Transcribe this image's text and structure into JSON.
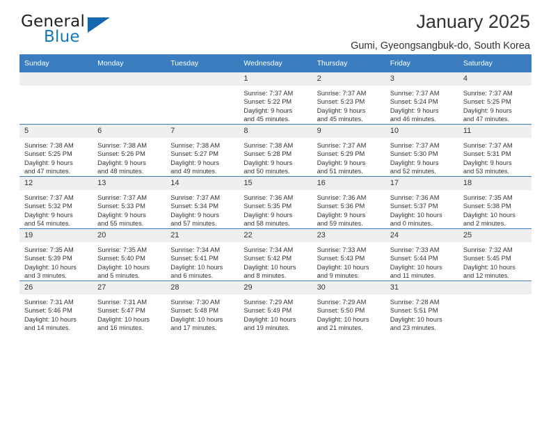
{
  "brand": {
    "name_part1": "General",
    "name_part2": "Blue",
    "triangle_color": "#1568b0",
    "blue_color": "#1278be"
  },
  "header": {
    "title": "January 2025",
    "location": "Gumi, Gyeongsangbuk-do, South Korea"
  },
  "theme": {
    "header_row_bg": "#3a7ebf",
    "day_number_bg": "#efefef",
    "text_color": "#333333"
  },
  "weekday_headers": [
    "Sunday",
    "Monday",
    "Tuesday",
    "Wednesday",
    "Thursday",
    "Friday",
    "Saturday"
  ],
  "weeks": [
    [
      {
        "day": "",
        "empty": true,
        "sunrise": "",
        "sunset": "",
        "daylight1": "",
        "daylight2": ""
      },
      {
        "day": "",
        "empty": true,
        "sunrise": "",
        "sunset": "",
        "daylight1": "",
        "daylight2": ""
      },
      {
        "day": "",
        "empty": true,
        "sunrise": "",
        "sunset": "",
        "daylight1": "",
        "daylight2": ""
      },
      {
        "day": "1",
        "empty": false,
        "sunrise": "Sunrise: 7:37 AM",
        "sunset": "Sunset: 5:22 PM",
        "daylight1": "Daylight: 9 hours",
        "daylight2": "and 45 minutes."
      },
      {
        "day": "2",
        "empty": false,
        "sunrise": "Sunrise: 7:37 AM",
        "sunset": "Sunset: 5:23 PM",
        "daylight1": "Daylight: 9 hours",
        "daylight2": "and 45 minutes."
      },
      {
        "day": "3",
        "empty": false,
        "sunrise": "Sunrise: 7:37 AM",
        "sunset": "Sunset: 5:24 PM",
        "daylight1": "Daylight: 9 hours",
        "daylight2": "and 46 minutes."
      },
      {
        "day": "4",
        "empty": false,
        "sunrise": "Sunrise: 7:37 AM",
        "sunset": "Sunset: 5:25 PM",
        "daylight1": "Daylight: 9 hours",
        "daylight2": "and 47 minutes."
      }
    ],
    [
      {
        "day": "5",
        "empty": false,
        "sunrise": "Sunrise: 7:38 AM",
        "sunset": "Sunset: 5:25 PM",
        "daylight1": "Daylight: 9 hours",
        "daylight2": "and 47 minutes."
      },
      {
        "day": "6",
        "empty": false,
        "sunrise": "Sunrise: 7:38 AM",
        "sunset": "Sunset: 5:26 PM",
        "daylight1": "Daylight: 9 hours",
        "daylight2": "and 48 minutes."
      },
      {
        "day": "7",
        "empty": false,
        "sunrise": "Sunrise: 7:38 AM",
        "sunset": "Sunset: 5:27 PM",
        "daylight1": "Daylight: 9 hours",
        "daylight2": "and 49 minutes."
      },
      {
        "day": "8",
        "empty": false,
        "sunrise": "Sunrise: 7:38 AM",
        "sunset": "Sunset: 5:28 PM",
        "daylight1": "Daylight: 9 hours",
        "daylight2": "and 50 minutes."
      },
      {
        "day": "9",
        "empty": false,
        "sunrise": "Sunrise: 7:37 AM",
        "sunset": "Sunset: 5:29 PM",
        "daylight1": "Daylight: 9 hours",
        "daylight2": "and 51 minutes."
      },
      {
        "day": "10",
        "empty": false,
        "sunrise": "Sunrise: 7:37 AM",
        "sunset": "Sunset: 5:30 PM",
        "daylight1": "Daylight: 9 hours",
        "daylight2": "and 52 minutes."
      },
      {
        "day": "11",
        "empty": false,
        "sunrise": "Sunrise: 7:37 AM",
        "sunset": "Sunset: 5:31 PM",
        "daylight1": "Daylight: 9 hours",
        "daylight2": "and 53 minutes."
      }
    ],
    [
      {
        "day": "12",
        "empty": false,
        "sunrise": "Sunrise: 7:37 AM",
        "sunset": "Sunset: 5:32 PM",
        "daylight1": "Daylight: 9 hours",
        "daylight2": "and 54 minutes."
      },
      {
        "day": "13",
        "empty": false,
        "sunrise": "Sunrise: 7:37 AM",
        "sunset": "Sunset: 5:33 PM",
        "daylight1": "Daylight: 9 hours",
        "daylight2": "and 55 minutes."
      },
      {
        "day": "14",
        "empty": false,
        "sunrise": "Sunrise: 7:37 AM",
        "sunset": "Sunset: 5:34 PM",
        "daylight1": "Daylight: 9 hours",
        "daylight2": "and 57 minutes."
      },
      {
        "day": "15",
        "empty": false,
        "sunrise": "Sunrise: 7:36 AM",
        "sunset": "Sunset: 5:35 PM",
        "daylight1": "Daylight: 9 hours",
        "daylight2": "and 58 minutes."
      },
      {
        "day": "16",
        "empty": false,
        "sunrise": "Sunrise: 7:36 AM",
        "sunset": "Sunset: 5:36 PM",
        "daylight1": "Daylight: 9 hours",
        "daylight2": "and 59 minutes."
      },
      {
        "day": "17",
        "empty": false,
        "sunrise": "Sunrise: 7:36 AM",
        "sunset": "Sunset: 5:37 PM",
        "daylight1": "Daylight: 10 hours",
        "daylight2": "and 0 minutes."
      },
      {
        "day": "18",
        "empty": false,
        "sunrise": "Sunrise: 7:35 AM",
        "sunset": "Sunset: 5:38 PM",
        "daylight1": "Daylight: 10 hours",
        "daylight2": "and 2 minutes."
      }
    ],
    [
      {
        "day": "19",
        "empty": false,
        "sunrise": "Sunrise: 7:35 AM",
        "sunset": "Sunset: 5:39 PM",
        "daylight1": "Daylight: 10 hours",
        "daylight2": "and 3 minutes."
      },
      {
        "day": "20",
        "empty": false,
        "sunrise": "Sunrise: 7:35 AM",
        "sunset": "Sunset: 5:40 PM",
        "daylight1": "Daylight: 10 hours",
        "daylight2": "and 5 minutes."
      },
      {
        "day": "21",
        "empty": false,
        "sunrise": "Sunrise: 7:34 AM",
        "sunset": "Sunset: 5:41 PM",
        "daylight1": "Daylight: 10 hours",
        "daylight2": "and 6 minutes."
      },
      {
        "day": "22",
        "empty": false,
        "sunrise": "Sunrise: 7:34 AM",
        "sunset": "Sunset: 5:42 PM",
        "daylight1": "Daylight: 10 hours",
        "daylight2": "and 8 minutes."
      },
      {
        "day": "23",
        "empty": false,
        "sunrise": "Sunrise: 7:33 AM",
        "sunset": "Sunset: 5:43 PM",
        "daylight1": "Daylight: 10 hours",
        "daylight2": "and 9 minutes."
      },
      {
        "day": "24",
        "empty": false,
        "sunrise": "Sunrise: 7:33 AM",
        "sunset": "Sunset: 5:44 PM",
        "daylight1": "Daylight: 10 hours",
        "daylight2": "and 11 minutes."
      },
      {
        "day": "25",
        "empty": false,
        "sunrise": "Sunrise: 7:32 AM",
        "sunset": "Sunset: 5:45 PM",
        "daylight1": "Daylight: 10 hours",
        "daylight2": "and 12 minutes."
      }
    ],
    [
      {
        "day": "26",
        "empty": false,
        "sunrise": "Sunrise: 7:31 AM",
        "sunset": "Sunset: 5:46 PM",
        "daylight1": "Daylight: 10 hours",
        "daylight2": "and 14 minutes."
      },
      {
        "day": "27",
        "empty": false,
        "sunrise": "Sunrise: 7:31 AM",
        "sunset": "Sunset: 5:47 PM",
        "daylight1": "Daylight: 10 hours",
        "daylight2": "and 16 minutes."
      },
      {
        "day": "28",
        "empty": false,
        "sunrise": "Sunrise: 7:30 AM",
        "sunset": "Sunset: 5:48 PM",
        "daylight1": "Daylight: 10 hours",
        "daylight2": "and 17 minutes."
      },
      {
        "day": "29",
        "empty": false,
        "sunrise": "Sunrise: 7:29 AM",
        "sunset": "Sunset: 5:49 PM",
        "daylight1": "Daylight: 10 hours",
        "daylight2": "and 19 minutes."
      },
      {
        "day": "30",
        "empty": false,
        "sunrise": "Sunrise: 7:29 AM",
        "sunset": "Sunset: 5:50 PM",
        "daylight1": "Daylight: 10 hours",
        "daylight2": "and 21 minutes."
      },
      {
        "day": "31",
        "empty": false,
        "sunrise": "Sunrise: 7:28 AM",
        "sunset": "Sunset: 5:51 PM",
        "daylight1": "Daylight: 10 hours",
        "daylight2": "and 23 minutes."
      },
      {
        "day": "",
        "empty": true,
        "sunrise": "",
        "sunset": "",
        "daylight1": "",
        "daylight2": ""
      }
    ]
  ]
}
